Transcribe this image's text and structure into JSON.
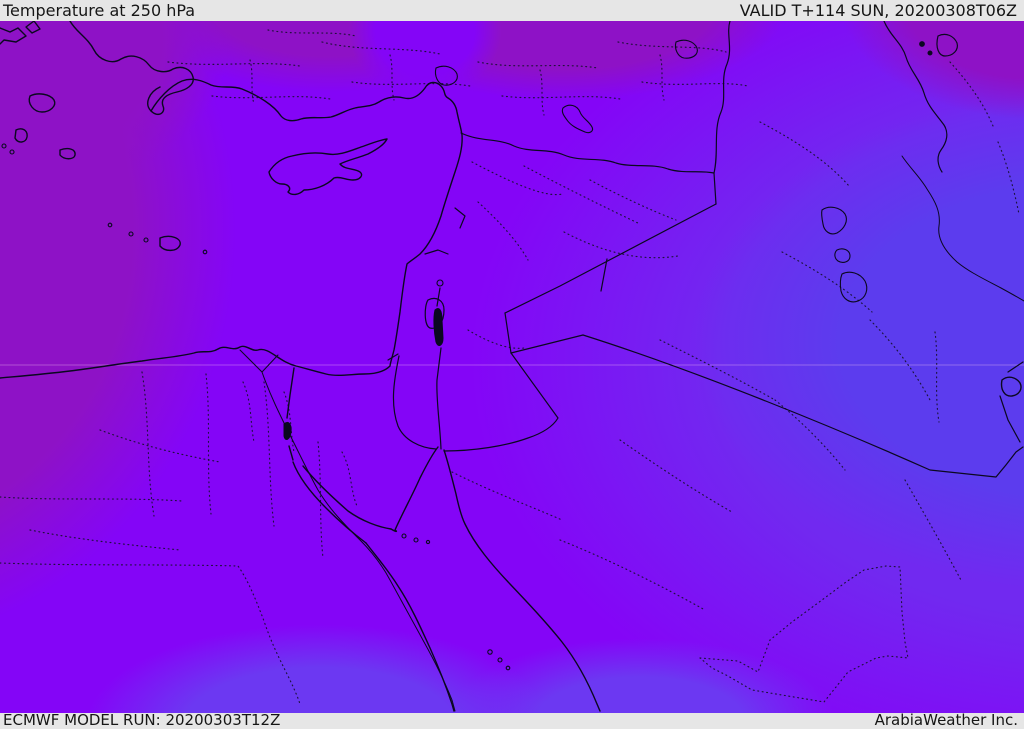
{
  "header": {
    "title": "Temperature at 250 hPa",
    "valid_label": "VALID T+114 SUN, 20200308T06Z"
  },
  "footer": {
    "model_run_label": "ECMWF MODEL RUN: 20200303T12Z",
    "credit_label": "ArabiaWeather Inc."
  },
  "map": {
    "parameter": "Temperature",
    "pressure_level": "250 hPa",
    "model": "ECMWF",
    "forecast_step": "T+114",
    "valid_time": "20200308T06Z",
    "run_time": "20200303T12Z",
    "provider": "ArabiaWeather Inc.",
    "colors": {
      "bar_bg": "#e6e6e6",
      "bar_text": "#161616",
      "base_violet": "#8405f7",
      "muted_purple": "#8e12c6",
      "blue_violet_mid": "#7129f0",
      "blue_east": "#5c3cee",
      "blue_south_patch": "#6c38f2",
      "line": "#0b0820"
    },
    "layers": [
      "temperature-shading",
      "coastlines",
      "country-borders",
      "admin-borders-dotted",
      "rivers",
      "lakes",
      "latitude-gridline"
    ]
  }
}
